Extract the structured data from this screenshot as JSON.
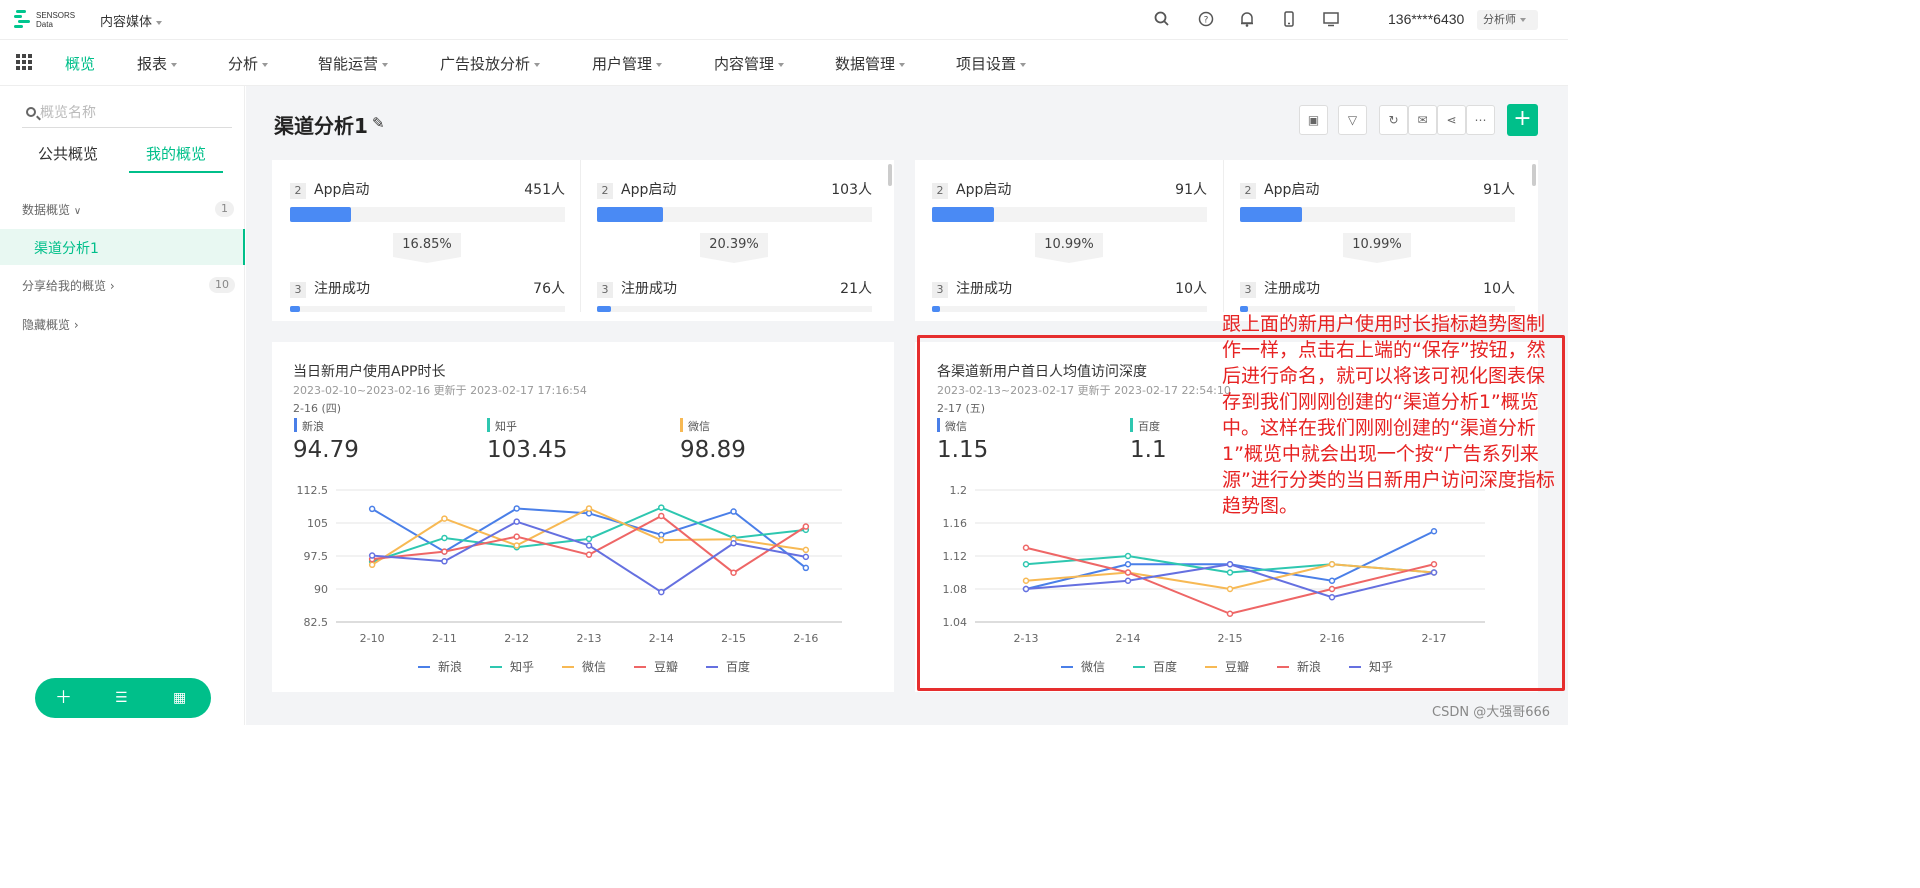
{
  "topbar": {
    "logo_line1": "SENSORS",
    "logo_line2": "Data",
    "project": "内容媒体",
    "user": "136****6430",
    "role": "分析师"
  },
  "nav": {
    "items": [
      "概览",
      "报表",
      "分析",
      "智能运营",
      "广告投放分析",
      "用户管理",
      "内容管理",
      "数据管理",
      "项目设置"
    ]
  },
  "sidebar": {
    "search_placeholder": "概览名称",
    "tab_public": "公共概览",
    "tab_mine": "我的概览",
    "group_data": "数据概览",
    "group_data_count": "1",
    "active_item": "渠道分析1",
    "group_shared": "分享给我的概览",
    "group_shared_count": "10",
    "group_hidden": "隐藏概览"
  },
  "page": {
    "title": "渠道分析1"
  },
  "funnels": [
    {
      "step2": "App启动",
      "step2_val": "451人",
      "step2_pct": 0.22,
      "conv": "16.85%",
      "step3": "注册成功",
      "step3_val": "76人",
      "step3_pct": 0.037
    },
    {
      "step2": "App启动",
      "step2_val": "103人",
      "step2_pct": 0.24,
      "conv": "20.39%",
      "step3": "注册成功",
      "step3_val": "21人",
      "step3_pct": 0.05
    },
    {
      "step2": "App启动",
      "step2_val": "91人",
      "step2_pct": 0.225,
      "conv": "10.99%",
      "step3": "注册成功",
      "step3_val": "10人",
      "step3_pct": 0.025
    },
    {
      "step2": "App启动",
      "step2_val": "91人",
      "step2_pct": 0.225,
      "conv": "10.99%",
      "step3": "注册成功",
      "step3_val": "10人",
      "step3_pct": 0.025
    }
  ],
  "step_labels": {
    "two": "2",
    "three": "3"
  },
  "chart1": {
    "title": "当日新用户使用APP时长",
    "subtitle": "2023-02-10~2023-02-16 更新于 2023-02-17 17:16:54",
    "date_label": "2-16 (四)",
    "highlights": [
      {
        "name": "新浪",
        "value": "94.79",
        "color": "#4a7fe8"
      },
      {
        "name": "知乎",
        "value": "103.45",
        "color": "#2ec7b0"
      },
      {
        "name": "微信",
        "value": "98.89",
        "color": "#f7b954"
      }
    ]
  },
  "chart2": {
    "title": "各渠道新用户首日人均值访问深度",
    "subtitle": "2023-02-13~2023-02-17 更新于 2023-02-17 22:54:10",
    "date_label": "2-17 (五)",
    "highlights": [
      {
        "name": "微信",
        "value": "1.15",
        "color": "#4a7fe8"
      },
      {
        "name": "百度",
        "value": "1.1",
        "color": "#2ec7b0"
      }
    ]
  },
  "chart_data": [
    {
      "type": "line",
      "title": "当日新用户使用APP时长",
      "x": [
        "2-10",
        "2-11",
        "2-12",
        "2-13",
        "2-14",
        "2-15",
        "2-16"
      ],
      "ylim": [
        82.5,
        112.5
      ],
      "yticks": [
        "112.5",
        "105",
        "97.5",
        "90",
        "82.5"
      ],
      "grid": true,
      "legend": "bottom",
      "series": [
        {
          "name": "新浪",
          "color": "#4a7fe8",
          "values": [
            108.2,
            98.5,
            108.3,
            107.2,
            102.3,
            107.6,
            94.79
          ]
        },
        {
          "name": "知乎",
          "color": "#2ec7b0",
          "values": [
            96.2,
            101.6,
            99.5,
            101.4,
            108.5,
            101.6,
            103.45
          ]
        },
        {
          "name": "微信",
          "color": "#f7b954",
          "values": [
            95.5,
            106.0,
            99.9,
            108.3,
            101.1,
            101.3,
            98.89
          ]
        },
        {
          "name": "豆瓣",
          "color": "#ee6666",
          "values": [
            96.8,
            98.5,
            101.9,
            97.8,
            106.6,
            93.7,
            104.2
          ]
        },
        {
          "name": "百度",
          "color": "#6570e0",
          "values": [
            97.6,
            96.3,
            105.3,
            99.9,
            89.3,
            100.4,
            97.3
          ]
        }
      ]
    },
    {
      "type": "line",
      "title": "各渠道新用户首日人均值访问深度",
      "x": [
        "2-13",
        "2-14",
        "2-15",
        "2-16",
        "2-17"
      ],
      "ylim": [
        1.04,
        1.2
      ],
      "yticks": [
        "1.2",
        "1.16",
        "1.12",
        "1.08",
        "1.04"
      ],
      "grid": true,
      "legend": "bottom",
      "series": [
        {
          "name": "微信",
          "color": "#4a7fe8",
          "values": [
            1.08,
            1.11,
            1.11,
            1.09,
            1.15
          ]
        },
        {
          "name": "百度",
          "color": "#2ec7b0",
          "values": [
            1.11,
            1.12,
            1.1,
            1.11,
            1.1
          ]
        },
        {
          "name": "豆瓣",
          "color": "#f7b954",
          "values": [
            1.09,
            1.1,
            1.08,
            1.11,
            1.1
          ]
        },
        {
          "name": "新浪",
          "color": "#ee6666",
          "values": [
            1.13,
            1.1,
            1.05,
            1.08,
            1.11
          ]
        },
        {
          "name": "知乎",
          "color": "#6570e0",
          "values": [
            1.08,
            1.09,
            1.11,
            1.07,
            1.1
          ]
        }
      ]
    }
  ],
  "annotation": {
    "text": "跟上面的新用户使用时长指标趋势图制作一样，点击右上端的“保存”按钮，然后进行命名，就可以将该可视化图表保存到我们刚刚创建的“渠道分析1”概览中。这样在我们刚刚创建的“渠道分析1”概览中就会出现一个按“广告系列来源”进行分类的当日新用户访问深度指标趋势图。"
  },
  "watermark": "CSDN @大强哥666"
}
